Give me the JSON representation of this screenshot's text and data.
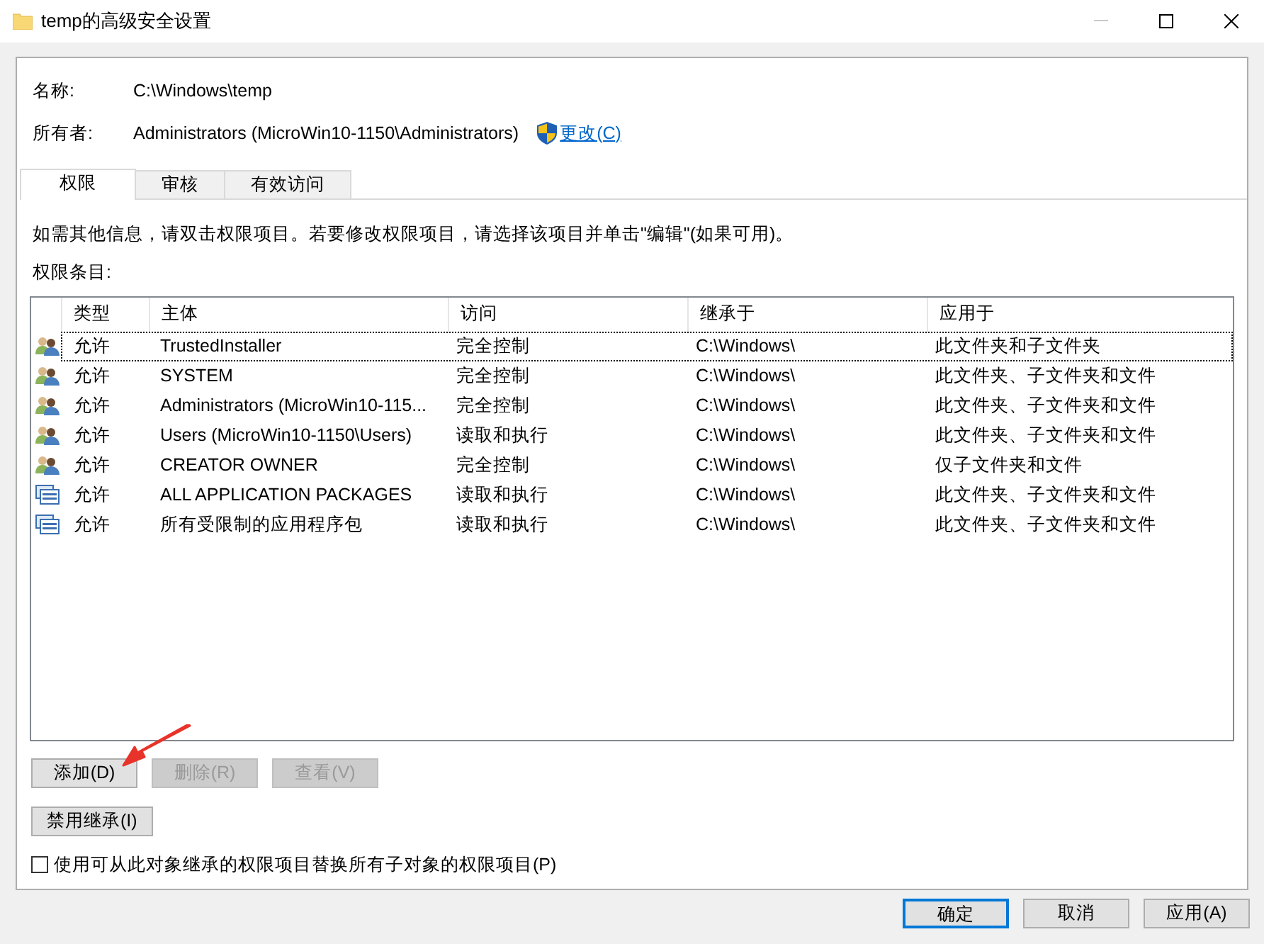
{
  "window": {
    "title": "temp的高级安全设置"
  },
  "fields": [
    {
      "label": "名称:",
      "value": "C:\\Windows\\temp"
    },
    {
      "label": "所有者:",
      "value": "Administrators (MicroWin10-1150\\Administrators)",
      "link": "更改(C)"
    }
  ],
  "tabs": [
    {
      "label": "权限",
      "selected": true
    },
    {
      "label": "审核",
      "selected": false
    },
    {
      "label": "有效访问",
      "selected": false
    }
  ],
  "info_text": "如需其他信息，请双击权限项目。若要修改权限项目，请选择该项目并单击\"编辑\"(如果可用)。",
  "list_label": "权限条目:",
  "table": {
    "columns": [
      "类型",
      "主体",
      "访问",
      "继承于",
      "应用于"
    ],
    "rows": [
      {
        "kind": "users",
        "focused": true,
        "cells": [
          "允许",
          "TrustedInstaller",
          "完全控制",
          "C:\\Windows\\",
          "此文件夹和子文件夹"
        ]
      },
      {
        "kind": "users",
        "focused": false,
        "cells": [
          "允许",
          "SYSTEM",
          "完全控制",
          "C:\\Windows\\",
          "此文件夹、子文件夹和文件"
        ]
      },
      {
        "kind": "users",
        "focused": false,
        "cells": [
          "允许",
          "Administrators (MicroWin10-115...",
          "完全控制",
          "C:\\Windows\\",
          "此文件夹、子文件夹和文件"
        ]
      },
      {
        "kind": "users",
        "focused": false,
        "cells": [
          "允许",
          "Users (MicroWin10-1150\\Users)",
          "读取和执行",
          "C:\\Windows\\",
          "此文件夹、子文件夹和文件"
        ]
      },
      {
        "kind": "users",
        "focused": false,
        "cells": [
          "允许",
          "CREATOR OWNER",
          "完全控制",
          "C:\\Windows\\",
          "仅子文件夹和文件"
        ]
      },
      {
        "kind": "package",
        "focused": false,
        "cells": [
          "允许",
          "ALL APPLICATION PACKAGES",
          "读取和执行",
          "C:\\Windows\\",
          "此文件夹、子文件夹和文件"
        ]
      },
      {
        "kind": "package",
        "focused": false,
        "cells": [
          "允许",
          "所有受限制的应用程序包",
          "读取和执行",
          "C:\\Windows\\",
          "此文件夹、子文件夹和文件"
        ]
      }
    ]
  },
  "row_buttons": [
    {
      "label": "添加(D)",
      "disabled": false
    },
    {
      "label": "删除(R)",
      "disabled": true
    },
    {
      "label": "查看(V)",
      "disabled": true
    }
  ],
  "inherit_button": {
    "label": "禁用继承(I)",
    "disabled": false
  },
  "replace_checkbox": {
    "label": "使用可从此对象继承的权限项目替换所有子对象的权限项目(P)",
    "checked": false
  },
  "dialog_buttons": [
    {
      "label": "确定",
      "default": true
    },
    {
      "label": "取消",
      "default": false
    },
    {
      "label": "应用(A)",
      "default": false
    }
  ],
  "annotations": [
    {
      "kind": "arrow",
      "color": "#e8332a"
    }
  ]
}
